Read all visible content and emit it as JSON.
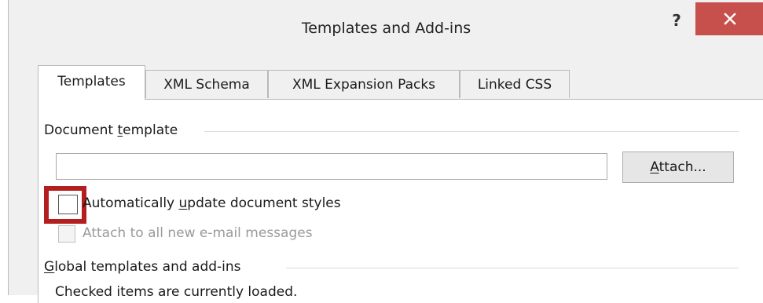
{
  "dialog": {
    "title": "Templates and Add-ins",
    "help_label": "?",
    "close_icon": "close-icon",
    "close_color": "#c7504d"
  },
  "tabs": [
    {
      "label": "Templates",
      "active": true
    },
    {
      "label": "XML Schema",
      "active": false
    },
    {
      "label": "XML Expansion Packs",
      "active": false
    },
    {
      "label": "Linked CSS",
      "active": false
    }
  ],
  "document_template": {
    "group_label_pre": "Document ",
    "group_label_u": "t",
    "group_label_post": "emplate",
    "path_value": "",
    "attach_label_u": "A",
    "attach_label_post": "ttach..."
  },
  "options": {
    "auto_update_pre": "Automatically ",
    "auto_update_u": "u",
    "auto_update_post": "pdate document styles",
    "auto_update_checked": false,
    "attach_email_label": "Attach to all new e-mail messages",
    "attach_email_enabled": false
  },
  "global_templates": {
    "group_label_u": "G",
    "group_label_post": "lobal templates and add-ins",
    "hint_text": "Checked items are currently loaded."
  },
  "highlight_color": "#b31e1e"
}
